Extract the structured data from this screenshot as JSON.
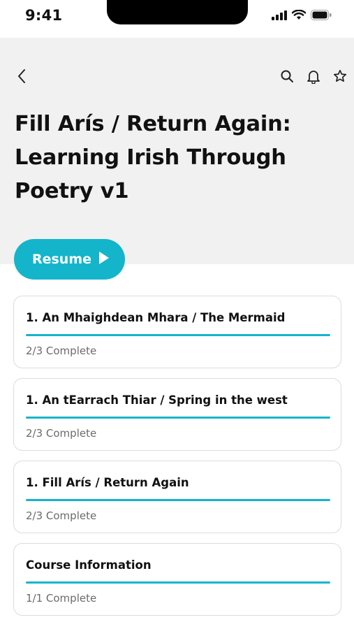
{
  "status_bar": {
    "time": "9:41",
    "icons": [
      "cellular-signal-icon",
      "wifi-icon",
      "battery-icon"
    ]
  },
  "header": {
    "back_icon": "chevron-left-icon",
    "actions": [
      "search-icon",
      "bell-icon",
      "star-icon"
    ],
    "title": "Fill Arís / Return Again: Learning Irish Through Poetry v1"
  },
  "resume_button": {
    "label": "Resume",
    "icon": "play-icon"
  },
  "modules": [
    {
      "title": "1. An Mhaighdean Mhara / The Mermaid",
      "status": "2/3 Complete",
      "progress": 1.0
    },
    {
      "title": "1. An tEarrach Thiar / Spring in the west",
      "status": "2/3 Complete",
      "progress": 1.0
    },
    {
      "title": "1. Fill Arís / Return Again",
      "status": "2/3 Complete",
      "progress": 1.0
    },
    {
      "title": "Course Information",
      "status": "1/1 Complete",
      "progress": 1.0
    }
  ],
  "colors": {
    "accent": "#14b5cb",
    "header_bg": "#f1f1f1",
    "card_border": "#dcdcdc",
    "muted_text": "#6b6b6b"
  }
}
